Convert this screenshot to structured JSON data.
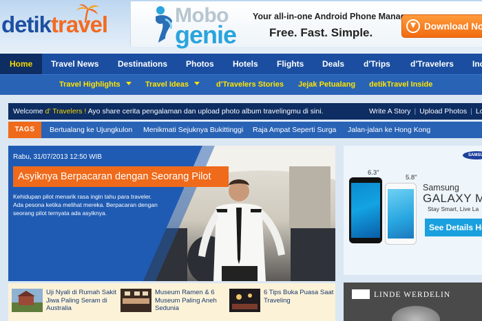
{
  "header": {
    "logo_part1": "detik",
    "logo_part2": "travel"
  },
  "ad_banner": {
    "brand_top": "Mobo",
    "brand_bottom": "genie",
    "tagline": "Your all-in-one Android Phone Manager",
    "slogan": "Free. Fast. Simple.",
    "button_label": "Download Now"
  },
  "main_nav": [
    {
      "label": "Home"
    },
    {
      "label": "Travel News"
    },
    {
      "label": "Destinations"
    },
    {
      "label": "Photos"
    },
    {
      "label": "Hotels"
    },
    {
      "label": "Flights"
    },
    {
      "label": "Deals"
    },
    {
      "label": "d'Trips"
    },
    {
      "label": "d'Travelers"
    },
    {
      "label": "Inc"
    }
  ],
  "sub_nav": [
    {
      "label": "Travel Highlights"
    },
    {
      "label": "Travel Ideas"
    },
    {
      "label": "d'Travelers Stories"
    },
    {
      "label": "Jejak Petualang"
    },
    {
      "label": "detikTravel Inside"
    }
  ],
  "welcome": {
    "prefix": "Welcome ",
    "highlight": "d' Travelers !",
    "text": " Ayo share cerita pengalaman dan upload photo album travelingmu di sini.",
    "link1": "Write A Story",
    "link2": "Upload Photos",
    "link3": "Lo"
  },
  "tags": {
    "label": "TAGS",
    "items": [
      "Bertualang ke Ujungkulon",
      "Menikmati Sejuknya Bukittinggi",
      "Raja Ampat Seperti Surga",
      "Jalan-jalan ke Hong Kong"
    ]
  },
  "hero": {
    "date": "Rabu, 31/07/2013 12:50 WIB",
    "title": "Asyiknya Berpacaran dengan Seorang Pilot",
    "description": "Kehidupan pilot menarik rasa ingin tahu para traveler. Ada pesona ketika melihat mereka. Berpacaran dengan seorang pilot ternyata ada asyiknya."
  },
  "stories": [
    {
      "title": "Uji Nyali di Rumah Sakit Jiwa Paling Seram di Australia"
    },
    {
      "title": "Museum Ramen & 6 Museum Paling Aneh Sedunia"
    },
    {
      "title": "6 Tips Buka Puasa Saat Traveling"
    }
  ],
  "ad_samsung": {
    "brand": "SAMSUNG",
    "size1": "6.3\"",
    "size2": "5.8\"",
    "line1": "Samsung",
    "line2": "GALAXY Mega",
    "line3": "Stay Smart, Live La",
    "button": "See Details Here"
  },
  "ad_watch": {
    "brand": "LINDE WERDELIN"
  },
  "colors": {
    "brand_blue": "#1b4ea0",
    "accent_orange": "#ef6a1a",
    "nav_yellow": "#ffe400",
    "dark_navy": "#0d2d63"
  }
}
